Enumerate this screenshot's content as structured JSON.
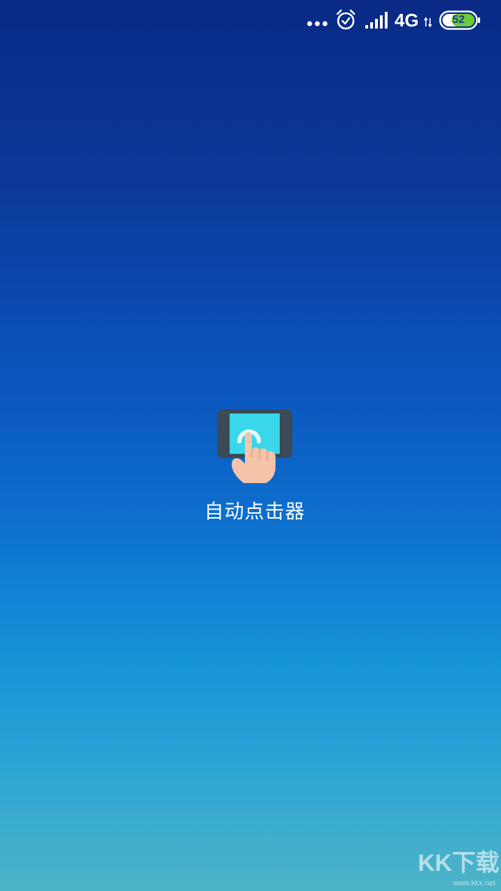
{
  "status_bar": {
    "network": "4G",
    "battery": "52",
    "icons": [
      "more-dots-icon",
      "alarm-icon",
      "signal-icon",
      "data-arrows-icon",
      "battery-icon"
    ]
  },
  "splash": {
    "app_name": "自动点击器",
    "icon": "tap-hand-phone-icon"
  },
  "watermark": {
    "main": "KK下载",
    "sub": "www.kkx.net"
  },
  "colors": {
    "gradient_top": "#0a2a86",
    "gradient_mid": "#0e73cf",
    "gradient_bottom": "#4eb4c7",
    "icon_screen": "#3ad6ea",
    "icon_frame": "#3b4a55",
    "hand": "#f5c3a8",
    "battery_fill": "#6ccb3a"
  }
}
